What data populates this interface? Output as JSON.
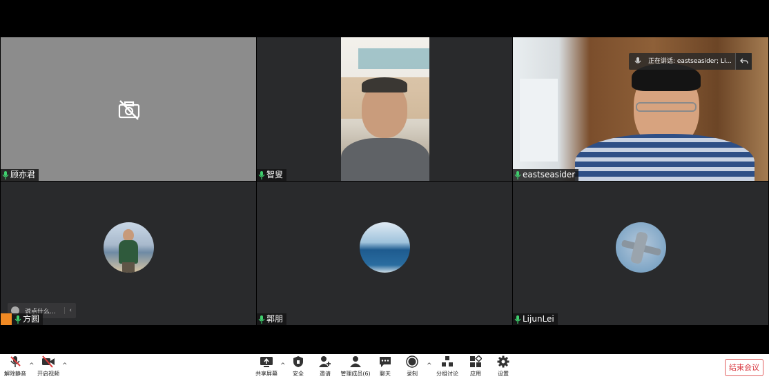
{
  "participants": [
    {
      "name": "顾亦君",
      "video": "off"
    },
    {
      "name": "智叟",
      "video": "on"
    },
    {
      "name": "eastseasider",
      "video": "on",
      "speaking": true
    },
    {
      "name": "方圆",
      "video": "avatar"
    },
    {
      "name": "郭朋",
      "video": "avatar"
    },
    {
      "name": "LijunLei",
      "video": "avatar"
    }
  ],
  "speaking_indicator": {
    "text": "正在讲话: eastseasider; Li..."
  },
  "chat_bubble": {
    "placeholder": "说点什么..."
  },
  "toolbar": {
    "unmute": "解除静音",
    "start_video": "开启视频",
    "share_screen": "共享屏幕",
    "security": "安全",
    "invite": "邀请",
    "manage_participants": "管理成员(6)",
    "chat": "聊天",
    "record": "录制",
    "breakout": "分组讨论",
    "apps": "应用",
    "settings": "设置",
    "end_meeting": "结束会议"
  },
  "colors": {
    "accent_green": "#3fa36a",
    "end_red": "#d9363e",
    "tile_dark": "#292a2c",
    "tile_grey": "#8c8c8c"
  }
}
